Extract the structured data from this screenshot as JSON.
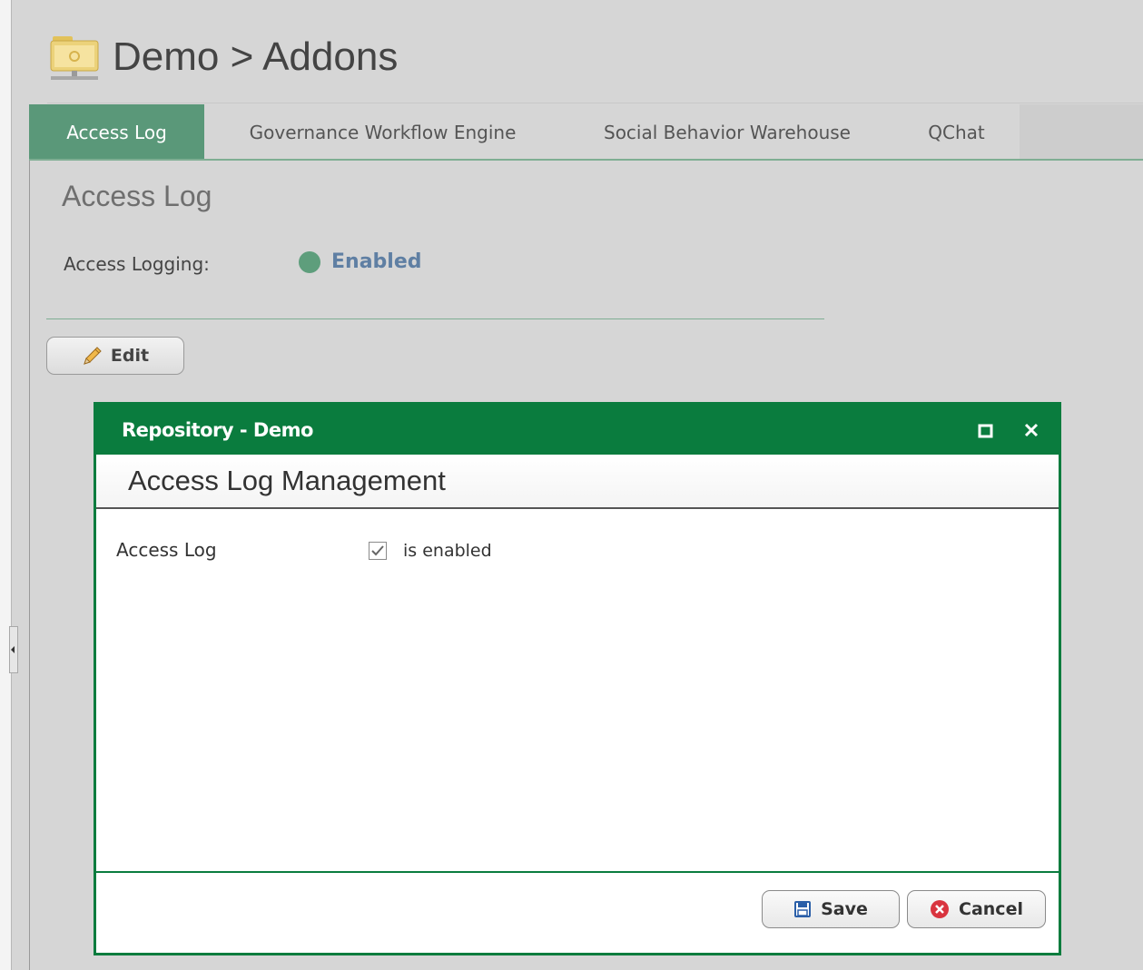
{
  "header": {
    "title": "Demo > Addons"
  },
  "tabs": [
    {
      "label": "Access Log",
      "active": true
    },
    {
      "label": "Governance Workflow Engine",
      "active": false
    },
    {
      "label": "Social Behavior Warehouse",
      "active": false
    },
    {
      "label": "QChat",
      "active": false
    }
  ],
  "section": {
    "title": "Access Log",
    "field_label": "Access Logging:",
    "status_text": "Enabled",
    "status_color": "#5e9e7c"
  },
  "edit_button": {
    "label": "Edit",
    "icon": "pencil-icon"
  },
  "dialog": {
    "title": "Repository - Demo",
    "heading": "Access Log Management",
    "field_label": "Access Log",
    "checkbox_label": "is enabled",
    "checkbox_checked": true,
    "save_label": "Save",
    "cancel_label": "Cancel",
    "accent_color": "#0a7c3e"
  }
}
